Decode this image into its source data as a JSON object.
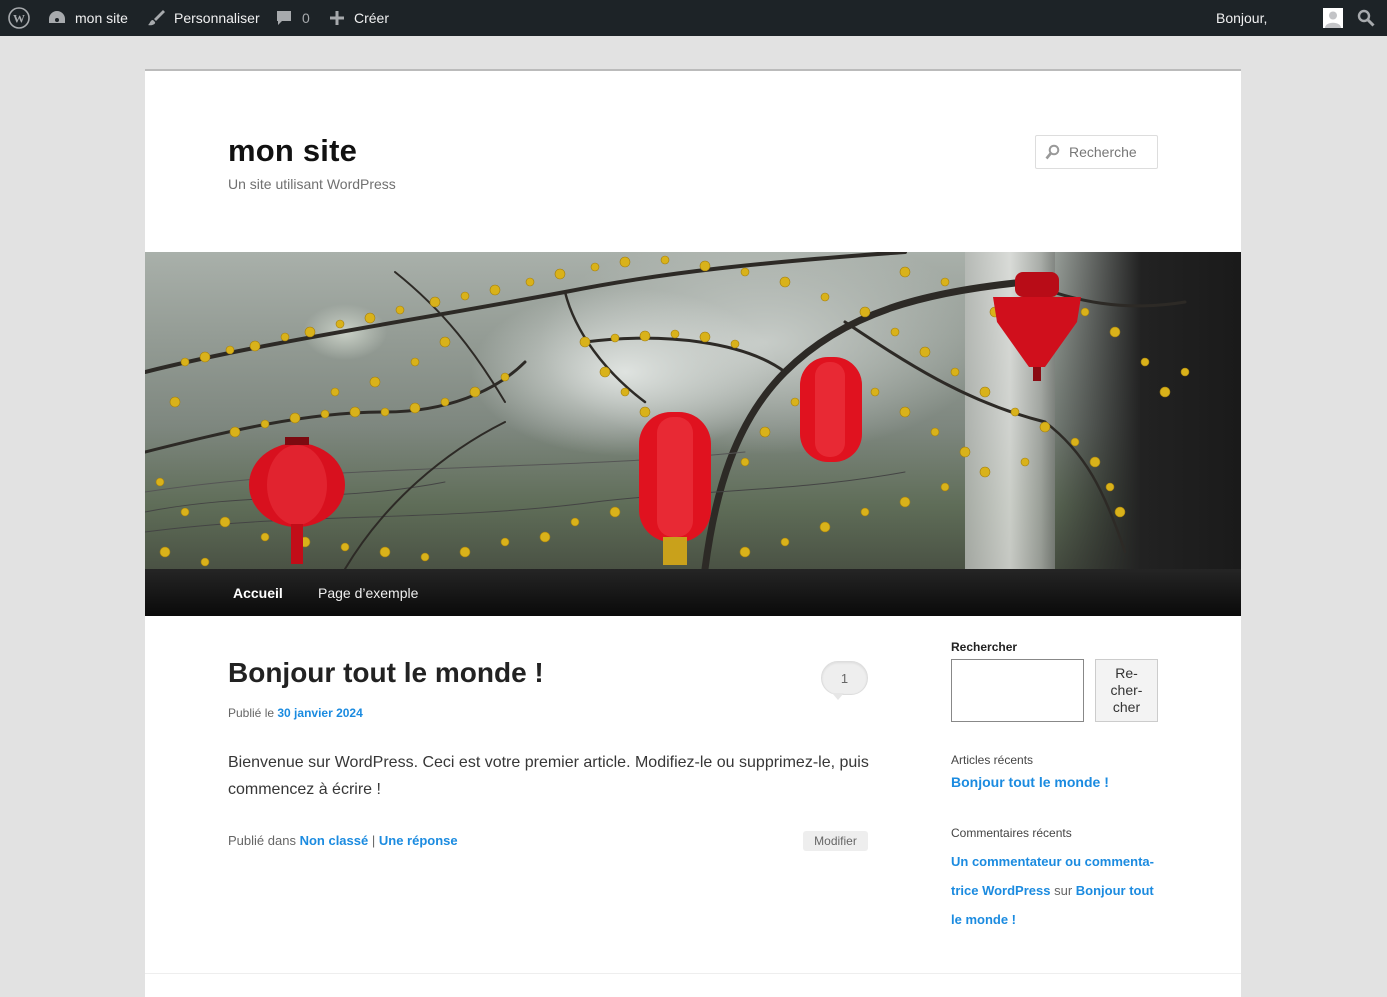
{
  "admin_bar": {
    "site_name": "mon site",
    "customize": "Personnaliser",
    "comments_count": "0",
    "new": "Créer",
    "greeting": "Bonjour,"
  },
  "header": {
    "site_title": "mon site",
    "site_description": "Un site utilisant WordPress",
    "search_placeholder": "Recherche"
  },
  "nav": {
    "items": [
      {
        "label": "Accueil",
        "active": true
      },
      {
        "label": "Page d’exemple",
        "active": false
      }
    ]
  },
  "post": {
    "title": "Bonjour tout le monde !",
    "comment_count": "1",
    "meta_prefix": "Publié le",
    "date": "30 janvier 2024",
    "content": "Bienvenue sur WordPress. Ceci est votre premier article. Modifiez-le ou supprimez-le, puis commencez à écrire !",
    "footer_prefix": "Publié dans",
    "category": "Non classé",
    "separator": "|",
    "reply": "Une réponse",
    "edit": "Modifier"
  },
  "sidebar": {
    "search_title": "Rechercher",
    "search_button": "Re-\ncher-\ncher",
    "recent_posts_title": "Articles récents",
    "recent_post": "Bonjour tout le monde !",
    "recent_comments_title": "Commentaires récents",
    "comment_author": "Un commentateur ou commenta-trice WordPress",
    "comment_on": "sur",
    "comment_post": "Bonjour tout le monde !"
  },
  "colors": {
    "admin_bar_bg": "#1d2327",
    "link": "#1b8be0",
    "nav_bg": "#111111",
    "lantern_red": "#e0121f",
    "blossom_yellow": "#d9b21a"
  }
}
